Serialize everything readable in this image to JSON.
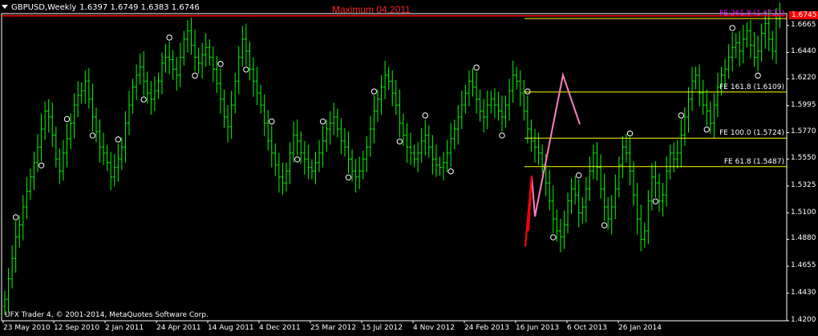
{
  "header": {
    "symbol": "GBPUSD,Weekly",
    "ohlc": "1.6397 1.6749 1.6383 1.6746"
  },
  "annotation_max": "Maximum 04.2011",
  "copyright": "UFX Trader 4, © 2001-2014, MetaQuotes Software Corp.",
  "colors": {
    "background": "#000000",
    "candles": "#00ff00",
    "fib_lines": "#ffff00",
    "max_line": "#ff0000",
    "zigzag": "#ff7fbf",
    "fe_top_label": "#ff00ff"
  },
  "y_axis": {
    "min": 1.42,
    "max": 1.675,
    "ticks": [
      "1.6665",
      "1.6440",
      "1.6220",
      "1.5995",
      "1.5770",
      "1.5550",
      "1.5325",
      "1.5100",
      "1.4880",
      "1.4655",
      "1.4430",
      "1.4200"
    ],
    "current_price": "1.6745"
  },
  "x_axis": {
    "labels": [
      "23 May 2010",
      "12 Sep 2010",
      "2 Jan 2011",
      "24 Apr 2011",
      "14 Aug 2011",
      "4 Dec 2011",
      "25 Mar 2012",
      "15 Jul 2012",
      "4 Nov 2012",
      "24 Feb 2013",
      "16 Jun 2013",
      "6 Oct 2013",
      "26 Jan 2014"
    ]
  },
  "fib_levels": [
    {
      "label": "FE 261.8 (1.6722)",
      "price": 1.6722
    },
    {
      "label": "FE 161.8 (1.6109)",
      "price": 1.6109
    },
    {
      "label": "FE 100.0 (1.5724)",
      "price": 1.5724
    },
    {
      "label": "FE 61.8 (1.5487)",
      "price": 1.5487
    }
  ],
  "chart_data": {
    "type": "bar",
    "title": "GBPUSD,Weekly",
    "xlabel": "",
    "ylabel": "",
    "ylim": [
      1.42,
      1.675
    ],
    "max_line": 1.6745,
    "series_points": [
      {
        "name": "weekly_close",
        "values": [
          1.438,
          1.455,
          1.472,
          1.49,
          1.5,
          1.515,
          1.528,
          1.54,
          1.552,
          1.565,
          1.58,
          1.595,
          1.59,
          1.575,
          1.555,
          1.545,
          1.56,
          1.572,
          1.585,
          1.6,
          1.608,
          1.612,
          1.62,
          1.605,
          1.59,
          1.578,
          1.565,
          1.56,
          1.552,
          1.54,
          1.548,
          1.555,
          1.565,
          1.585,
          1.6,
          1.615,
          1.625,
          1.632,
          1.62,
          1.61,
          1.605,
          1.612,
          1.62,
          1.635,
          1.64,
          1.638,
          1.63,
          1.625,
          1.64,
          1.655,
          1.662,
          1.65,
          1.64,
          1.635,
          1.642,
          1.648,
          1.64,
          1.63,
          1.618,
          1.605,
          1.59,
          1.582,
          1.6,
          1.62,
          1.64,
          1.655,
          1.645,
          1.63,
          1.62,
          1.61,
          1.6,
          1.585,
          1.57,
          1.56,
          1.55,
          1.54,
          1.535,
          1.545,
          1.56,
          1.575,
          1.57,
          1.56,
          1.555,
          1.548,
          1.545,
          1.552,
          1.56,
          1.57,
          1.58,
          1.585,
          1.59,
          1.58,
          1.57,
          1.565,
          1.555,
          1.545,
          1.54,
          1.545,
          1.555,
          1.565,
          1.58,
          1.595,
          1.605,
          1.615,
          1.625,
          1.62,
          1.61,
          1.6,
          1.585,
          1.575,
          1.565,
          1.56,
          1.555,
          1.56,
          1.57,
          1.575,
          1.565,
          1.555,
          1.55,
          1.548,
          1.552,
          1.56,
          1.572,
          1.58,
          1.59,
          1.6,
          1.61,
          1.62,
          1.615,
          1.605,
          1.595,
          1.59,
          1.6,
          1.605,
          1.6,
          1.595,
          1.59,
          1.6,
          1.612,
          1.625,
          1.62,
          1.61,
          1.595,
          1.58,
          1.57,
          1.565,
          1.56,
          1.55,
          1.535,
          1.52,
          1.505,
          1.495,
          1.49,
          1.5,
          1.52,
          1.53,
          1.525,
          1.51,
          1.515,
          1.53,
          1.545,
          1.56,
          1.548,
          1.53,
          1.515,
          1.505,
          1.515,
          1.53,
          1.55,
          1.565,
          1.56,
          1.545,
          1.525,
          1.505,
          1.488,
          1.495,
          1.52,
          1.54,
          1.535,
          1.52,
          1.525,
          1.545,
          1.56,
          1.555,
          1.56,
          1.575,
          1.59,
          1.605,
          1.62,
          1.625,
          1.61,
          1.6,
          1.595,
          1.585,
          1.6,
          1.615,
          1.625,
          1.63,
          1.64,
          1.648,
          1.652,
          1.645,
          1.655,
          1.662,
          1.65,
          1.64,
          1.645,
          1.66,
          1.668,
          1.655,
          1.645,
          1.672,
          1.6746
        ]
      }
    ]
  }
}
